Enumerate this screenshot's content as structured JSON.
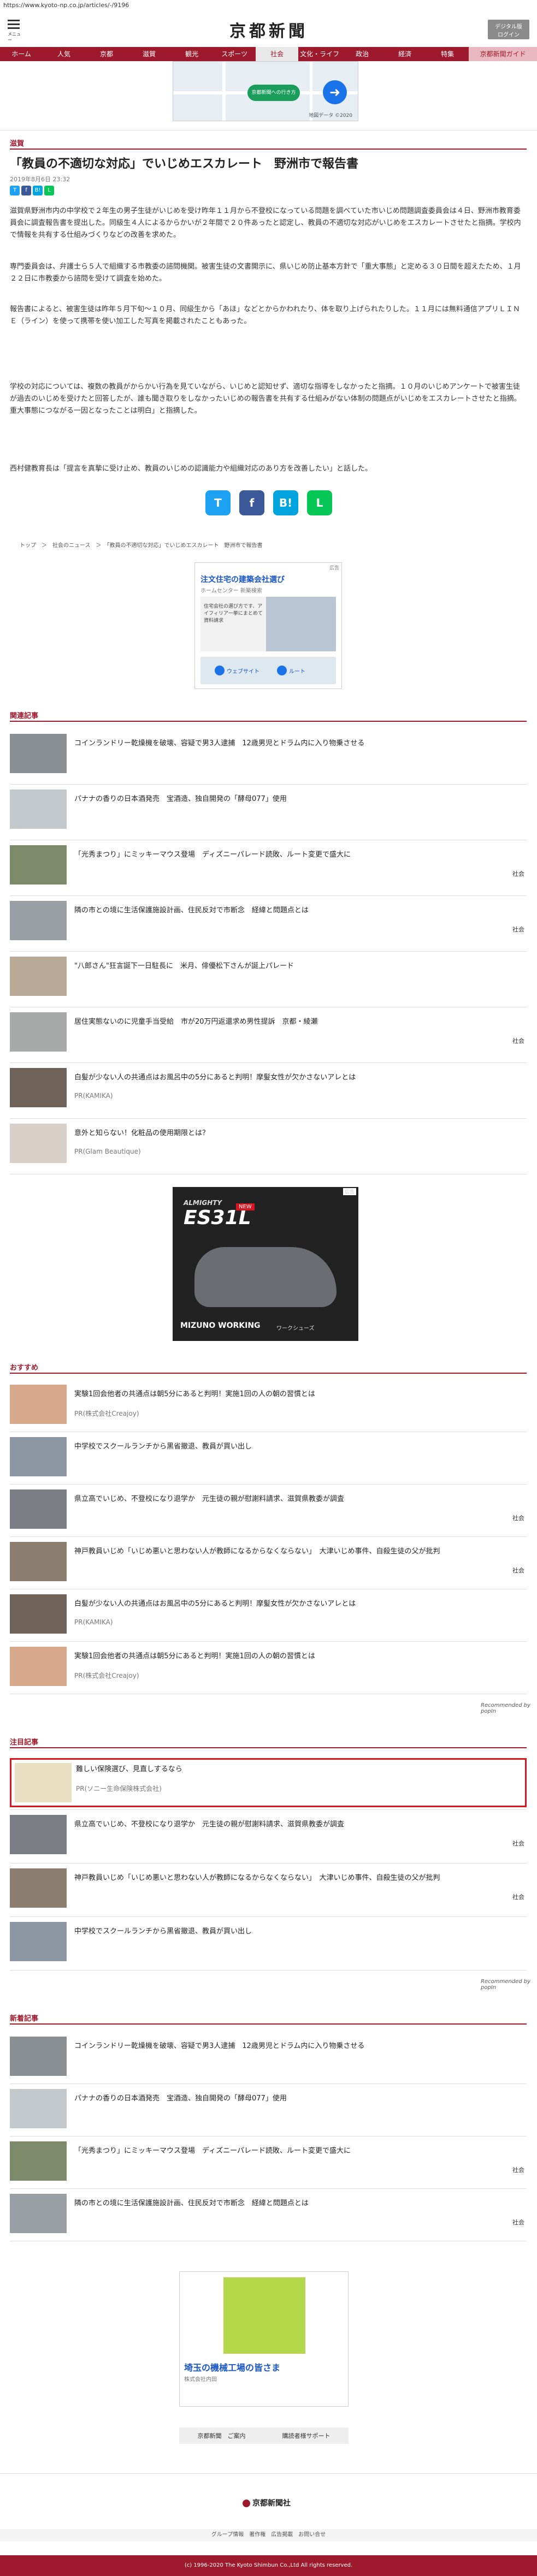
{
  "url": "https://www.kyoto-np.co.jp/articles/-/9196",
  "header": {
    "menu_label": "メニュー",
    "logo": "京都新聞",
    "digital_button": "デジタル版\nログイン"
  },
  "nav": [
    "ホーム",
    "人気",
    "京都",
    "滋賀",
    "観光",
    "スポーツ",
    "社会",
    "文化・ライフ",
    "政治",
    "経済",
    "特集",
    "京都新聞ガイド"
  ],
  "nav_active_index": 6,
  "map_ad": {
    "pin": "京都新聞への行き方",
    "caption": "地図データ ©2020"
  },
  "article": {
    "section": "滋賀",
    "title": "「教員の不適切な対応」でいじめエスカレート　野洲市で報告書",
    "date": "2019年8月6日 23:32",
    "paragraphs": [
      "滋賀県野洲市内の中学校で２年生の男子生徒がいじめを受け昨年１１月から不登校になっている問題を調べていた市いじめ問題調査委員会は４日、野洲市教育委員会に調査報告書を提出した。同級生４人によるからかいが２年間で２０件あったと認定し、教員の不適切な対応がいじめをエスカレートさせたと指摘。学校内で情報を共有する仕組みづくりなどの改善を求めた。",
      "専門委員会は、弁護士ら５人で組織する市教委の諮問機関。被害生徒の文書開示に、県いじめ防止基本方針で「重大事態」と定める３０日間を超えたため、１月２２日に市教委から諮問を受けて調査を始めた。",
      "報告書によると、被害生徒は昨年５月下旬～１０月、同級生から「あほ」などとからかわれたり、体を取り上げられたりした。１１月には無料通信アプリＬＩＮＥ（ライン）を使って携帯を使い加工した写真を掲載されたこともあった。",
      "学校の対応については、複数の教員がからかい行為を見ていながら、いじめと認知せず、適切な指導をしなかったと指摘。１０月のいじめアンケートで被害生徒が過去のいじめを受けたと回答したが、誰も聞き取りをしなかったいじめの報告書を共有する仕組みがない体制の問題点がいじめをエスカレートさせたと指摘。重大事態につながる一因となったことは明白」と指摘した。",
      "西村健教育長は「提言を真摯に受け止め、教員のいじめの認識能力や組織対応のあり方を改善したい」と話した。"
    ],
    "share_small": [
      "T",
      "f",
      "B!",
      "L"
    ],
    "share_large": [
      "T",
      "f",
      "B!",
      "L"
    ],
    "breadcrumbs": "トップ　＞　社会のニュース　＞　「教員の不適切な対応」でいじめエスカレート　野洲市で報告書"
  },
  "ad_mid": {
    "label": "広告",
    "title": "注文住宅の建築会社選び",
    "sub": "ホームセンター 新築検索",
    "body": "住宅会社の選び方です、アイフィリア一挙にまとめて資料請求",
    "btn1": "ウェブサイト",
    "btn2": "ルート"
  },
  "related": {
    "heading": "関連記事",
    "items": [
      {
        "text": "コインランドリー乾燥機を破壊、容疑で男3人逮捕　12歳男児とドラム内に入り物乗させる",
        "pr": "",
        "tag": "",
        "thumb": "#8a8f94"
      },
      {
        "text": "パナナの香りの日本酒発売　宝酒造、独自開発の「酵母077」使用",
        "pr": "",
        "tag": "",
        "thumb": "#c2c8cc"
      },
      {
        "text": "「光秀まつり」にミッキーマウス登場　ディズニーパレード読敗、ルート変更で盛大に",
        "pr": "",
        "tag": "社会",
        "thumb": "#7c8a6a"
      },
      {
        "text": "隣の市との境に生活保護施設計画、住民反対で市断念　経緯と問題点とは",
        "pr": "",
        "tag": "社会",
        "thumb": "#9a9ea5"
      },
      {
        "text": "\"八郎さん\"狂言誕下一日駐長に　米月、俳優松下さんが誕上パレード",
        "pr": "",
        "tag": "",
        "thumb": "#b9aa98"
      },
      {
        "text": "居住実態ないのに児童手当受給　市が20万円返還求め男性提訴　京都・綾瀬",
        "pr": "",
        "tag": "社会",
        "thumb": "#a7aaa8"
      },
      {
        "text": "白髪が少ない人の共通点はお風呂中の5分にあると判明！摩髪女性が欠かさないアレとは",
        "pr": "PR(KAMIKA)",
        "tag": "",
        "thumb": "#6e6258"
      },
      {
        "text": "意外と知らない！化粧品の使用期限とは？",
        "pr": "PR(Glam Beautique)",
        "tag": "",
        "thumb": "#d8d0c8"
      }
    ]
  },
  "shoe_ad": {
    "label": "広告",
    "brand": "ALMIGHTY",
    "model": "ES31L",
    "new": "NEW",
    "maker": "MIZUNO WORKING",
    "sub": "ワークシューズ"
  },
  "recommend": {
    "heading": "おすすめ",
    "items": [
      {
        "text": "実験1回会他者の共通点は朝5分にあると判明！実施1回の人の朝の習慣とは",
        "pr": "PR(株式会社Creajoy)",
        "tag": "",
        "thumb": "#d7a88a"
      },
      {
        "text": "中学校でスクールランチから黒省撤退、教員が買い出し",
        "pr": "",
        "tag": "",
        "thumb": "#8d97a3"
      },
      {
        "text": "県立高でいじめ、不登校になり退学か　元生徒の親が慰謝料請求、滋賀県教委が調査",
        "pr": "",
        "tag": "社会",
        "thumb": "#7a7e84"
      },
      {
        "text": "神戸教員いじめ「いじめ悪いと思わない人が教師になるからなくならない」　大津いじめ事件、自殺生徒の父が批判",
        "pr": "",
        "tag": "社会",
        "thumb": "#8c7e6e"
      },
      {
        "text": "白髪が少ない人の共通点はお風呂中の5分にあると判明！摩髪女性が欠かさないアレとは",
        "pr": "PR(KAMIKA)",
        "tag": "",
        "thumb": "#6e6258"
      },
      {
        "text": "実験1回会他者の共通点は朝5分にあると判明！実施1回の人の朝の習慣とは",
        "pr": "PR(株式会社Creajoy)",
        "tag": "",
        "thumb": "#d7a88a"
      }
    ],
    "footer": "Recommended by popIn"
  },
  "attention": {
    "heading": "注目記事",
    "items": [
      {
        "text": "難しい保険選び、見直しするなら",
        "pr": "PR(ソニー生命保険株式会社)",
        "tag": "",
        "thumb": "#e8e0c0",
        "highlight": true
      },
      {
        "text": "県立高でいじめ、不登校になり退学か　元生徒の親が慰謝料請求、滋賀県教委が調査",
        "pr": "",
        "tag": "社会",
        "thumb": "#7a7e84",
        "highlight": false
      },
      {
        "text": "神戸教員いじめ「いじめ悪いと思わない人が教師になるからなくならない」　大津いじめ事件、自殺生徒の父が批判",
        "pr": "",
        "tag": "社会",
        "thumb": "#8c7e6e",
        "highlight": false
      },
      {
        "text": "中学校でスクールランチから黒省撤退、教員が買い出し",
        "pr": "",
        "tag": "",
        "thumb": "#8d97a3",
        "highlight": false
      }
    ],
    "footer": "Recommended by popIn"
  },
  "newest": {
    "heading": "新着記事",
    "items": [
      {
        "text": "コインランドリー乾燥機を破壊、容疑で男3人逮捕　12歳男児とドラム内に入り物乗させる",
        "pr": "",
        "tag": "",
        "thumb": "#8a8f94"
      },
      {
        "text": "パナナの香りの日本酒発売　宝酒造、独自開発の「酵母077」使用",
        "pr": "",
        "tag": "",
        "thumb": "#c2c8cc"
      },
      {
        "text": "「光秀まつり」にミッキーマウス登場　ディズニーパレード読敗、ルート変更で盛大に",
        "pr": "",
        "tag": "社会",
        "thumb": "#7c8a6a"
      },
      {
        "text": "隣の市との境に生活保護施設計画、住民反対で市断念　経緯と問題点とは",
        "pr": "",
        "tag": "社会",
        "thumb": "#9a9ea5"
      }
    ]
  },
  "bottom_ad": {
    "title": "埼玉の機械工場の皆さま",
    "sub": "株式会社内田"
  },
  "footer_links": {
    "l1": "京都新聞　ご案内",
    "l2": "購読者様サポート"
  },
  "company": "京都新聞社",
  "footer_nav": "グループ情報　著作権　広告掲載　お問い合せ",
  "copyright": "(c) 1996-2020 The Kyoto Shimbun Co.,Ltd All rights reserved.",
  "colors": {
    "brand": "#9d1a2c",
    "highlight_border": "#d9151f"
  }
}
